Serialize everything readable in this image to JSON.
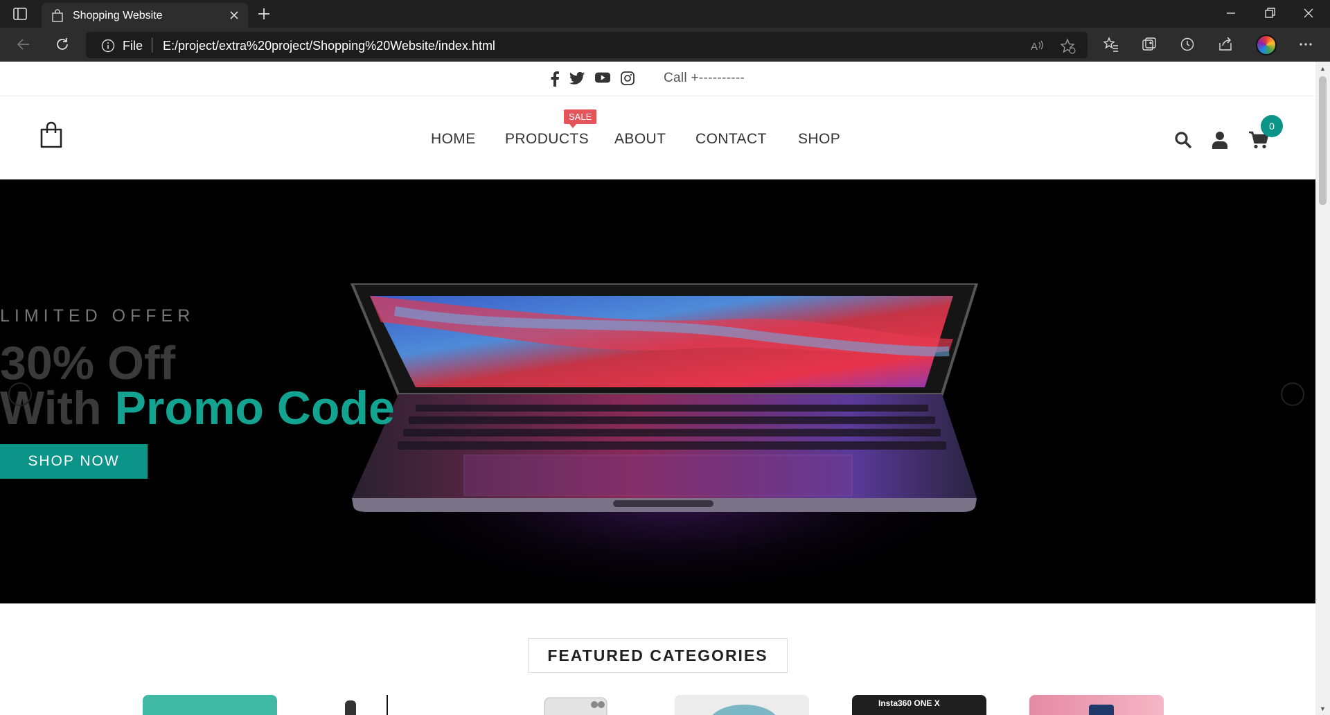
{
  "browser": {
    "tab_title": "Shopping Website",
    "omnibox_scheme": "File",
    "url": "E:/project/extra%20project/Shopping%20Website/index.html"
  },
  "topbar": {
    "social_icons": [
      "facebook-icon",
      "twitter-icon",
      "youtube-icon",
      "instagram-icon"
    ],
    "call_text": "Call +----------"
  },
  "header": {
    "menu": [
      "HOME",
      "PRODUCTS",
      "ABOUT",
      "CONTACT",
      "SHOP"
    ],
    "sale_badge": "SALE",
    "cart_count": "0"
  },
  "hero": {
    "kicker": "LIMITED OFFER",
    "headline_1": "30% Off",
    "headline_2_prefix": "With ",
    "headline_2_highlight": "Promo Code",
    "cta": "SHOP NOW"
  },
  "featured": {
    "title": "FEATURED CATEGORIES",
    "card_text": "Insta360 ONE X"
  },
  "colors": {
    "accent": "#0c9488",
    "sale": "#e5545b",
    "chrome_dark": "#202020"
  }
}
